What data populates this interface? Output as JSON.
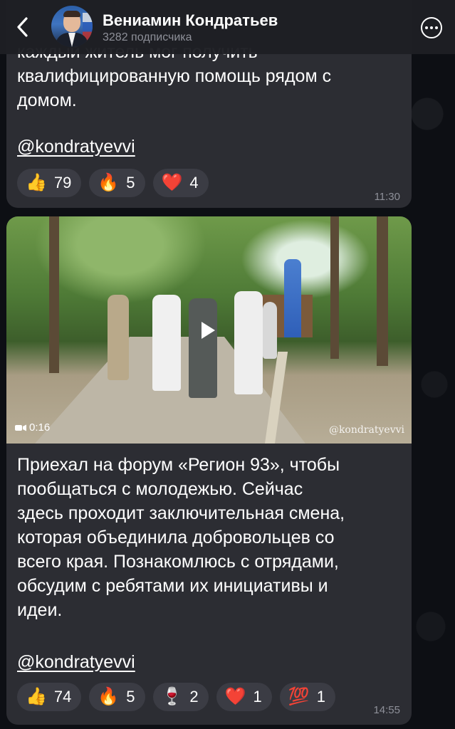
{
  "header": {
    "channel_name": "Вениамин Кондратьев",
    "subscribers": "3282 подписчика"
  },
  "messages": [
    {
      "text": "каждый житель мог получить\nквалифицированную помощь рядом с\nдомом.",
      "hashtag": "@kondratyevvi",
      "reactions": [
        {
          "emoji": "👍",
          "count": "79"
        },
        {
          "emoji": "🔥",
          "count": "5"
        },
        {
          "emoji": "❤️",
          "count": "4"
        }
      ],
      "time": "11:30"
    },
    {
      "video": {
        "duration": "0:16",
        "watermark": "@kondratyevvi"
      },
      "text": "Приехал на форум «Регион 93», чтобы\nпообщаться с молодежью. Сейчас\nздесь проходит заключительная смена,\nкоторая объединила добровольцев со\nвсего края. Познакомлюсь с отрядами,\nобсудим с ребятами их инициативы и\nидеи.",
      "hashtag": "@kondratyevvi",
      "reactions": [
        {
          "emoji": "👍",
          "count": "74"
        },
        {
          "emoji": "🔥",
          "count": "5"
        },
        {
          "emoji": "🍷",
          "count": "2"
        },
        {
          "emoji": "❤️",
          "count": "1"
        },
        {
          "emoji": "💯",
          "count": "1"
        }
      ],
      "time": "14:55"
    }
  ],
  "colors": {
    "background": "#0d0f14",
    "bubble": "#2c2d33",
    "reaction": "#3b3c44",
    "secondary_text": "#8e9099"
  }
}
